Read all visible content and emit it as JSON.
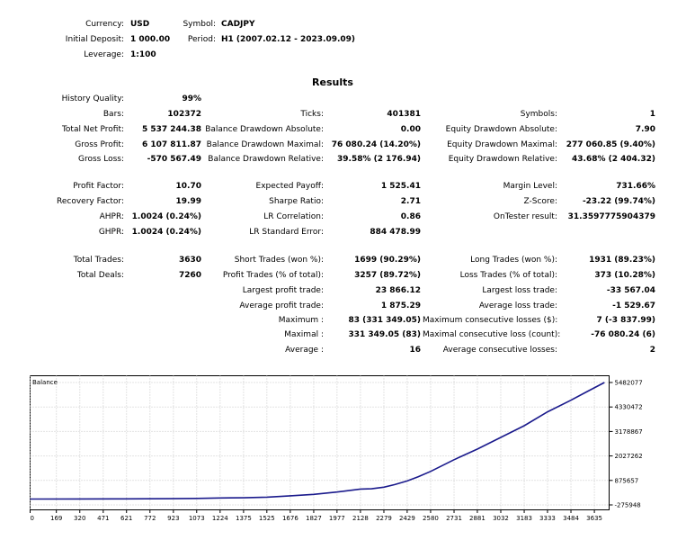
{
  "header": {
    "currency_label": "Currency:",
    "currency_value": "USD",
    "symbol_label": "Symbol:",
    "symbol_value": "CADJPY",
    "deposit_label": "Initial Deposit:",
    "deposit_value": "1 000.00",
    "period_label": "Period:",
    "period_value": "H1 (2007.02.12 - 2023.09.09)",
    "leverage_label": "Leverage:",
    "leverage_value": "1:100"
  },
  "results": {
    "title": "Results",
    "history_quality_label": "History Quality:",
    "history_quality_value": "99%",
    "col1": [
      {
        "label": "Bars:",
        "value": "102372"
      },
      {
        "label": "Total Net Profit:",
        "value": "5 537 244.38"
      },
      {
        "label": "Gross Profit:",
        "value": "6 107 811.87"
      },
      {
        "label": "Gross Loss:",
        "value": "-570 567.49"
      },
      {
        "label": "Profit Factor:",
        "value": "10.70"
      },
      {
        "label": "Recovery Factor:",
        "value": "19.99"
      },
      {
        "label": "AHPR:",
        "value": "1.0024 (0.24%)"
      },
      {
        "label": "GHPR:",
        "value": "1.0024 (0.24%)"
      },
      {
        "label": "Total Trades:",
        "value": "3630"
      },
      {
        "label": "Total Deals:",
        "value": "7260"
      }
    ],
    "col2": [
      {
        "label": "Ticks:",
        "value": "401381"
      },
      {
        "label": "Balance Drawdown Absolute:",
        "value": "0.00"
      },
      {
        "label": "Balance Drawdown Maximal:",
        "value": "76 080.24 (14.20%)"
      },
      {
        "label": "Balance Drawdown Relative:",
        "value": "39.58% (2 176.94)"
      },
      {
        "label": "Expected Payoff:",
        "value": "1 525.41"
      },
      {
        "label": "Sharpe Ratio:",
        "value": "2.71"
      },
      {
        "label": "LR Correlation:",
        "value": "0.86"
      },
      {
        "label": "LR Standard Error:",
        "value": "884 478.99"
      },
      {
        "label": "Short Trades (won %):",
        "value": "1699 (90.29%)"
      },
      {
        "label": "Profit Trades (% of total):",
        "value": "3257 (89.72%)"
      },
      {
        "label": "Largest profit trade:",
        "value": "23 866.12"
      },
      {
        "label": "Average profit trade:",
        "value": "1 875.29"
      },
      {
        "label": "Maximum :",
        "value": "83 (331 349.05)"
      },
      {
        "label": "Maximal :",
        "value": "331 349.05 (83)"
      },
      {
        "label": "Average :",
        "value": "16"
      }
    ],
    "col3": [
      {
        "label": "Symbols:",
        "value": "1"
      },
      {
        "label": "Equity Drawdown Absolute:",
        "value": "7.90"
      },
      {
        "label": "Equity Drawdown Maximal:",
        "value": "277 060.85 (9.40%)"
      },
      {
        "label": "Equity Drawdown Relative:",
        "value": "43.68% (2 404.32)"
      },
      {
        "label": "Margin Level:",
        "value": "731.66%"
      },
      {
        "label": "Z-Score:",
        "value": "-23.22 (99.74%)"
      },
      {
        "label": "OnTester result:",
        "value": "31.3597775904379"
      },
      {
        "label": "Long Trades (won %):",
        "value": "1931 (89.23%)"
      },
      {
        "label": "Loss Trades (% of total):",
        "value": "373 (10.28%)"
      },
      {
        "label": "Largest loss trade:",
        "value": "-33 567.04"
      },
      {
        "label": "Average loss trade:",
        "value": "-1 529.67"
      },
      {
        "label": "Maximum consecutive losses ($):",
        "value": "7 (-3 837.99)"
      },
      {
        "label": "Maximal consecutive loss (count):",
        "value": "-76 080.24 (6)"
      },
      {
        "label": "Average consecutive losses:",
        "value": "2"
      }
    ]
  },
  "colors": {
    "line": "#1a1a8c",
    "grid": "#c8c8c8",
    "border": "#000000"
  },
  "chart_data": {
    "type": "line",
    "title": "Balance",
    "x_ticks": [
      "0",
      "169",
      "320",
      "471",
      "621",
      "772",
      "923",
      "1073",
      "1224",
      "1375",
      "1525",
      "1676",
      "1827",
      "1977",
      "2128",
      "2279",
      "2429",
      "2580",
      "2731",
      "2881",
      "3032",
      "3183",
      "3333",
      "3484",
      "3635"
    ],
    "y_ticks": [
      "5482077",
      "4330472",
      "3178867",
      "2027262",
      "875657",
      "-275948"
    ],
    "xlim": [
      0,
      3730
    ],
    "ylim": [
      -275948,
      5482077
    ],
    "series": [
      {
        "x": [
          0,
          300,
          600,
          900,
          1073,
          1224,
          1375,
          1525,
          1676,
          1827,
          1977,
          2128,
          2200,
          2279,
          2350,
          2429,
          2500,
          2580,
          2731,
          2881,
          3032,
          3183,
          3333,
          3484,
          3600,
          3700
        ],
        "values": [
          1000,
          3000,
          6000,
          15000,
          30000,
          50000,
          60000,
          90000,
          150000,
          220000,
          330000,
          470000,
          480000,
          560000,
          680000,
          850000,
          1050000,
          1300000,
          1850000,
          2350000,
          2900000,
          3450000,
          4100000,
          4650000,
          5100000,
          5482077
        ]
      }
    ]
  }
}
